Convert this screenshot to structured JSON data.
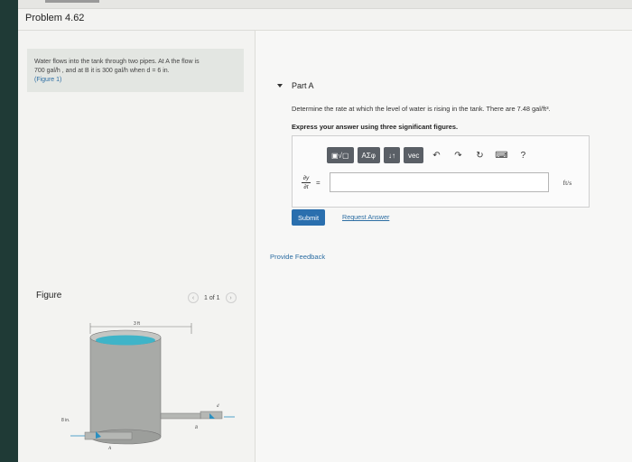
{
  "problem": {
    "title": "Problem 4.62"
  },
  "statement": {
    "line1": "Water flows into the tank through two pipes. At A the flow is",
    "line2": "700 gal/h , and at B it is 300 gal/h when d = 6 in.",
    "figure_link": "(Figure 1)"
  },
  "figure": {
    "label": "Figure",
    "pager_text": "1 of 1",
    "prev_icon": "chevron-left-icon",
    "next_icon": "chevron-right-icon",
    "dim_top": "3 ft",
    "dim_left": "8 in.",
    "label_a": "A",
    "label_b": "B",
    "label_d": "d"
  },
  "part": {
    "label": "Part A",
    "question": "Determine the rate at which the level of water is rising in the tank. There are 7.48 gal/ft³.",
    "instruction": "Express your answer using three significant figures."
  },
  "toolbar": {
    "templates": "▣√▢",
    "greek": "ΑΣφ",
    "arrows": "↓↑",
    "vec": "vec",
    "undo_icon": "undo-icon",
    "redo_icon": "redo-icon",
    "reset_icon": "reset-icon",
    "keyboard_icon": "keyboard-icon",
    "help": "?"
  },
  "answer": {
    "lhs_num": "∂y",
    "lhs_den": "∂t",
    "equals": "=",
    "value": "",
    "unit": "ft/s"
  },
  "actions": {
    "submit": "Submit",
    "request": "Request Answer",
    "feedback": "Provide Feedback"
  },
  "colors": {
    "accent": "#2a6fae",
    "water": "#3fb4c8",
    "tank": "#a8aaa7"
  }
}
